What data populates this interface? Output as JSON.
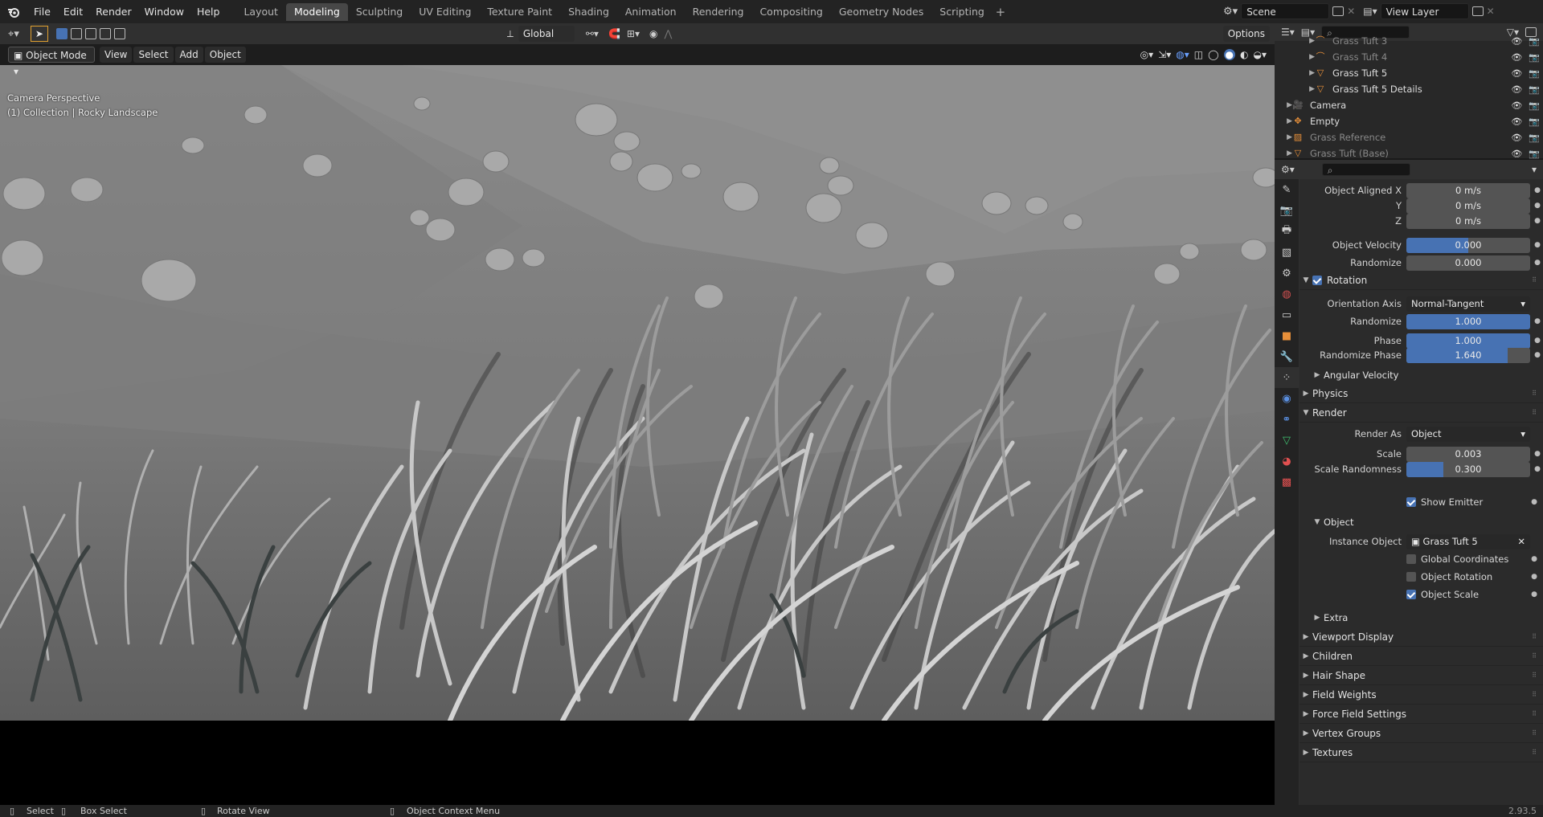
{
  "topbar": {
    "menus": [
      "File",
      "Edit",
      "Render",
      "Window",
      "Help"
    ],
    "workspace_tabs": [
      "Layout",
      "Modeling",
      "Sculpting",
      "UV Editing",
      "Texture Paint",
      "Shading",
      "Animation",
      "Rendering",
      "Compositing",
      "Geometry Nodes",
      "Scripting"
    ],
    "active_tab": "Modeling",
    "scene": "Scene",
    "view_layer": "View Layer"
  },
  "viewport_header": {
    "mode": "Object Mode",
    "menus": [
      "View",
      "Select",
      "Add",
      "Object"
    ],
    "transform_orientation": "Global",
    "options": "Options"
  },
  "viewport": {
    "camera_label": "Camera Perspective",
    "collection_label": "(1) Collection | Rocky Landscape"
  },
  "outliner": {
    "rows": [
      {
        "name": "Grass Tuft 3",
        "icon": "curve-icon",
        "dim": true
      },
      {
        "name": "Grass Tuft 4",
        "icon": "curve-icon",
        "dim": true
      },
      {
        "name": "Grass Tuft 5",
        "icon": "mesh-icon",
        "dim": false
      },
      {
        "name": "Grass Tuft 5 Details",
        "icon": "mesh-icon",
        "dim": false
      },
      {
        "name": "Camera",
        "icon": "camera-icon",
        "dim": false
      },
      {
        "name": "Empty",
        "icon": "empty-icon",
        "dim": false
      },
      {
        "name": "Grass Reference",
        "icon": "image-icon",
        "dim": true
      },
      {
        "name": "Grass Tuft (Base)",
        "icon": "mesh-icon",
        "dim": true
      }
    ]
  },
  "properties": {
    "object_aligned_x_label": "Object Aligned X",
    "object_aligned_x": "0 m/s",
    "y_label": "Y",
    "y_value": "0 m/s",
    "z_label": "Z",
    "z_value": "0 m/s",
    "object_velocity_label": "Object Velocity",
    "object_velocity": "0.000",
    "randomize_label": "Randomize",
    "randomize_velocity": "0.000",
    "rotation_panel": "Rotation",
    "orientation_axis_label": "Orientation Axis",
    "orientation_axis": "Normal-Tangent",
    "rot_randomize": "1.000",
    "rot_randomize_level": 1.0,
    "phase_label": "Phase",
    "phase": "1.000",
    "phase_level": 1.0,
    "randomize_phase_label": "Randomize Phase",
    "randomize_phase": "1.640",
    "randomize_phase_level": 0.82,
    "angular_velocity": "Angular Velocity",
    "physics": "Physics",
    "render": "Render",
    "render_as_label": "Render As",
    "render_as": "Object",
    "scale_label": "Scale",
    "scale": "0.003",
    "scale_randomness_label": "Scale Randomness",
    "scale_randomness": "0.300",
    "scale_randomness_level": 0.3,
    "show_emitter": "Show Emitter",
    "object_sub": "Object",
    "instance_object_label": "Instance Object",
    "instance_object": "Grass Tuft 5",
    "global_coordinates": "Global Coordinates",
    "object_rotation": "Object Rotation",
    "object_scale": "Object Scale",
    "extra": "Extra",
    "collapsed_panels": [
      "Viewport Display",
      "Children",
      "Hair Shape",
      "Field Weights",
      "Force Field Settings",
      "Vertex Groups",
      "Textures"
    ]
  },
  "statusbar": {
    "select": "Select",
    "box_select": "Box Select",
    "rotate_view": "Rotate View",
    "context_menu": "Object Context Menu",
    "version": "2.93.5"
  },
  "colors": {
    "accent": "#4772b3",
    "panel": "#303030",
    "header": "#232323"
  }
}
